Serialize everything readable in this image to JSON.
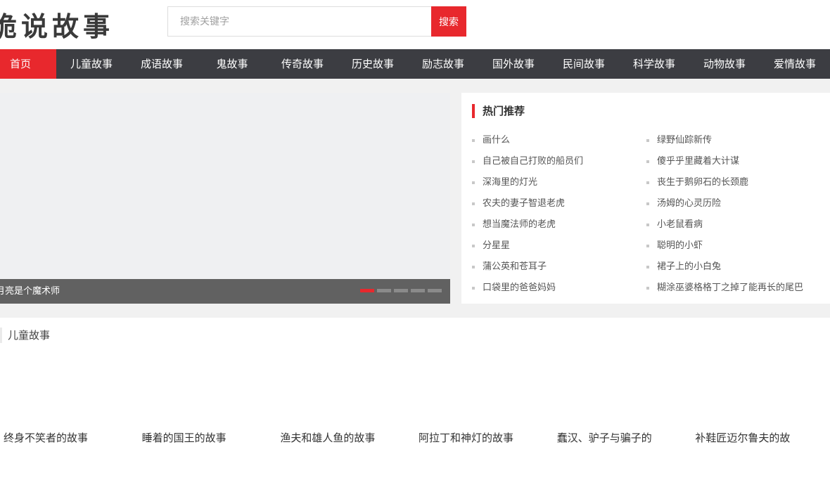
{
  "logo": {
    "text": "诡说故事"
  },
  "search": {
    "placeholder": "搜索关键字",
    "button_label": "搜索"
  },
  "nav": {
    "items": [
      "首页",
      "儿童故事",
      "成语故事",
      "鬼故事",
      "传奇故事",
      "历史故事",
      "励志故事",
      "国外故事",
      "民间故事",
      "科学故事",
      "动物故事",
      "爱情故事"
    ]
  },
  "slider": {
    "caption": "月亮是个魔术师",
    "dot_count": 5,
    "active_dot": 1
  },
  "hot": {
    "title": "热门推荐",
    "col1": [
      "画什么",
      "自己被自己打败的船员们",
      "深海里的灯光",
      "农夫的妻子智退老虎",
      "想当魔法师的老虎",
      "分星星",
      "蒲公英和苍耳子",
      "口袋里的爸爸妈妈"
    ],
    "col2": [
      "绿野仙踪新传",
      "傻乎乎里藏着大计谋",
      "丧生于鹅卵石的长颈鹿",
      "汤姆的心灵历险",
      "小老鼠看病",
      "聪明的小虾",
      "裙子上的小白兔",
      "糊涂巫婆格格丁之掉了能再长的尾巴"
    ]
  },
  "section": {
    "title": "儿童故事",
    "stories": [
      "终身不笑者的故事",
      "睡着的国王的故事",
      "渔夫和雄人鱼的故事",
      "阿拉丁和神灯的故事",
      "蠢汉、驴子与骗子的",
      "补鞋匠迈尔鲁夫的故"
    ]
  },
  "colors": {
    "accent": "#e8282d",
    "nav_bg": "#3c3d42",
    "band_bg": "#f1f1f1"
  }
}
